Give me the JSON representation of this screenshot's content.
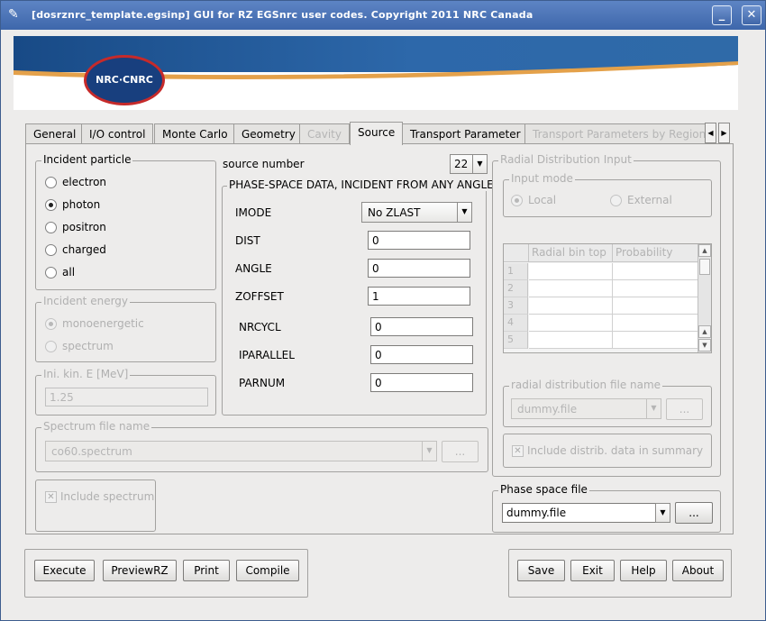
{
  "window": {
    "title": "[dosrznrc_template.egsinp] GUI for RZ EGSnrc user codes. Copyright 2011 NRC Canada",
    "minimize_glyph": "_",
    "close_glyph": "✕",
    "app_icon": "feather-icon"
  },
  "banner": {
    "logo_text": "NRC·CNRC"
  },
  "tabs": [
    {
      "label": "General",
      "state": "normal"
    },
    {
      "label": "I/O control",
      "state": "normal"
    },
    {
      "label": "Monte Carlo",
      "state": "normal"
    },
    {
      "label": "Geometry",
      "state": "normal"
    },
    {
      "label": "Cavity",
      "state": "disabled"
    },
    {
      "label": "Source",
      "state": "active"
    },
    {
      "label": "Transport Parameter",
      "state": "normal"
    },
    {
      "label": "Transport Parameters by Region",
      "state": "disabled"
    }
  ],
  "tab_scroll": {
    "left": "◀",
    "right": "▶"
  },
  "incident_particle": {
    "title": "Incident particle",
    "options": [
      "electron",
      "photon",
      "positron",
      "charged",
      "all"
    ],
    "selected": "photon"
  },
  "incident_energy": {
    "title": "Incident energy",
    "options": [
      "monoenergetic",
      "spectrum"
    ],
    "selected": "monoenergetic"
  },
  "ini_kin_e": {
    "title": "Ini. kin. E [MeV]",
    "value": "1.25"
  },
  "spectrum_file": {
    "title": "Spectrum file name",
    "value": "co60.spectrum",
    "browse": "..."
  },
  "include_spectrum": {
    "label": "Include spectrum",
    "checked": true
  },
  "source_number": {
    "label": "source number",
    "value": "22"
  },
  "phase_space": {
    "title": "PHASE-SPACE DATA, INCIDENT FROM ANY ANGLE",
    "imode_label": "IMODE",
    "imode_value": "No ZLAST",
    "fields": [
      {
        "label": "DIST",
        "value": "0"
      },
      {
        "label": "ANGLE",
        "value": "0"
      },
      {
        "label": "ZOFFSET",
        "value": "1"
      },
      {
        "label": "NRCYCL",
        "value": "0"
      },
      {
        "label": "IPARALLEL",
        "value": "0"
      },
      {
        "label": "PARNUM",
        "value": "0"
      }
    ]
  },
  "radial": {
    "title": "Radial Distribution Input",
    "input_mode_title": "Input mode",
    "input_modes": [
      "Local",
      "External"
    ],
    "selected_mode": "Local",
    "columns": [
      "Radial bin top",
      "Probability"
    ],
    "rows": [
      "1",
      "2",
      "3",
      "4",
      "5"
    ],
    "file_title": "radial distribution file name",
    "file_value": "dummy.file",
    "browse": "...",
    "include_label": "Include distrib. data in summary",
    "include_checked": true
  },
  "phase_space_file": {
    "title": "Phase space file",
    "value": "dummy.file",
    "browse": "..."
  },
  "actions_left": [
    "Execute",
    "PreviewRZ",
    "Print",
    "Compile"
  ],
  "actions_right": [
    "Save",
    "Exit",
    "Help",
    "About"
  ]
}
